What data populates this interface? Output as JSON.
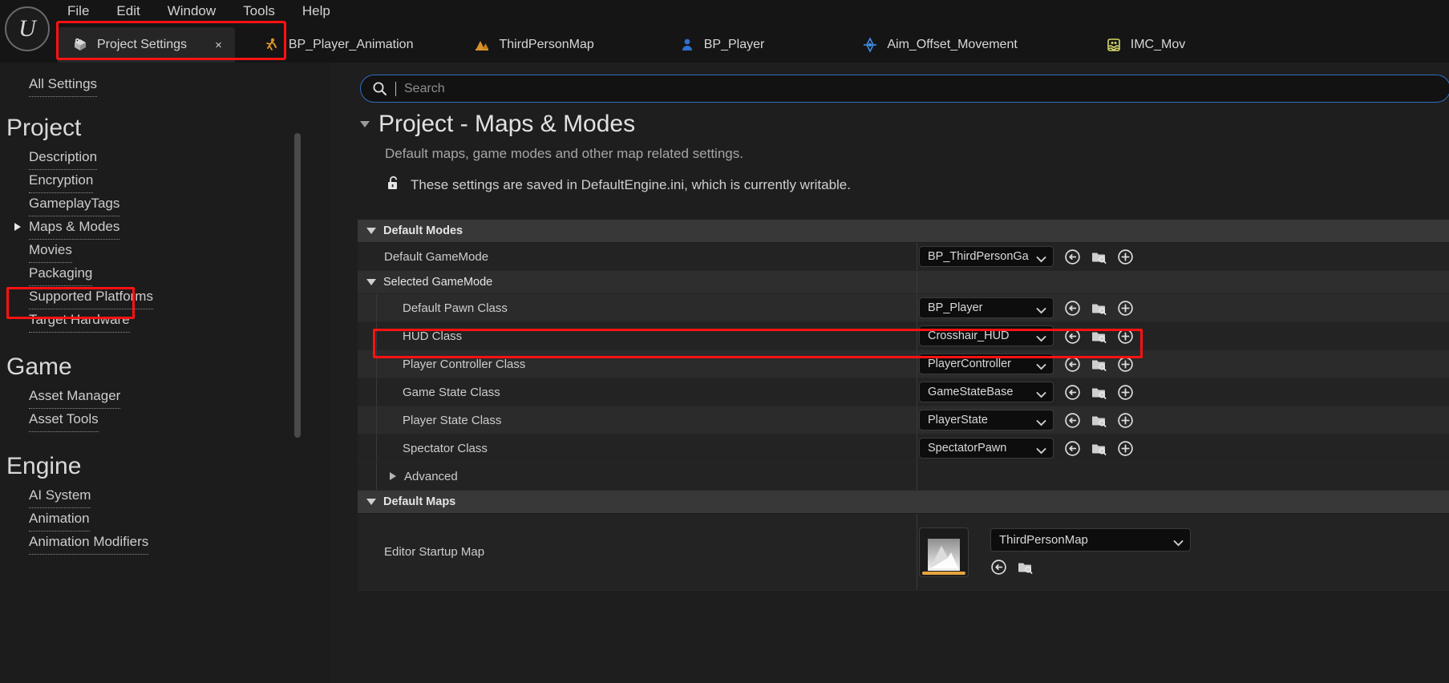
{
  "window": {
    "logo_glyph": "U"
  },
  "menubar": {
    "items": [
      {
        "label": "File"
      },
      {
        "label": "Edit"
      },
      {
        "label": "Window"
      },
      {
        "label": "Tools"
      },
      {
        "label": "Help"
      }
    ]
  },
  "tabs": [
    {
      "label": "Project Settings",
      "icon": "settings-box-icon",
      "active": true,
      "close": "×"
    },
    {
      "label": "BP_Player_Animation",
      "icon": "animation-blueprint-icon",
      "active": false
    },
    {
      "label": "ThirdPersonMap",
      "icon": "level-map-icon",
      "active": false
    },
    {
      "label": "BP_Player",
      "icon": "blueprint-actor-icon",
      "active": false
    },
    {
      "label": "Aim_Offset_Movement",
      "icon": "aim-offset-icon",
      "active": false
    },
    {
      "label": "IMC_Mov",
      "icon": "input-mapping-context-icon",
      "active": false
    }
  ],
  "sidebar": {
    "all_settings": "All Settings",
    "groups": [
      {
        "title": "Project",
        "items": [
          {
            "label": "Description",
            "selected": false
          },
          {
            "label": "Encryption",
            "selected": false
          },
          {
            "label": "GameplayTags",
            "selected": false
          },
          {
            "label": "Maps & Modes",
            "selected": true
          },
          {
            "label": "Movies",
            "selected": false
          },
          {
            "label": "Packaging",
            "selected": false
          },
          {
            "label": "Supported Platforms",
            "selected": false
          },
          {
            "label": "Target Hardware",
            "selected": false
          }
        ]
      },
      {
        "title": "Game",
        "items": [
          {
            "label": "Asset Manager",
            "selected": false
          },
          {
            "label": "Asset Tools",
            "selected": false
          }
        ]
      },
      {
        "title": "Engine",
        "items": [
          {
            "label": "AI System",
            "selected": false
          },
          {
            "label": "Animation",
            "selected": false
          },
          {
            "label": "Animation Modifiers",
            "selected": false
          }
        ]
      }
    ]
  },
  "search": {
    "placeholder": "Search",
    "value": ""
  },
  "page": {
    "title": "Project - Maps & Modes",
    "subtitle": "Default maps, game modes and other map related settings.",
    "note": "These settings are saved in DefaultEngine.ini, which is currently writable.",
    "note_icon": "unlock-icon"
  },
  "sections": {
    "default_modes": {
      "label": "Default Modes",
      "default_gamemode": {
        "label": "Default GameMode",
        "value": "BP_ThirdPersonGa"
      },
      "selected_gamemode": {
        "label": "Selected GameMode",
        "rows": [
          {
            "label": "Default Pawn Class",
            "value": "BP_Player",
            "highlighted": false
          },
          {
            "label": "HUD Class",
            "value": "Crosshair_HUD",
            "highlighted": true
          },
          {
            "label": "Player Controller Class",
            "value": "PlayerController",
            "highlighted": false
          },
          {
            "label": "Game State Class",
            "value": "GameStateBase",
            "highlighted": false
          },
          {
            "label": "Player State Class",
            "value": "PlayerState",
            "highlighted": false
          },
          {
            "label": "Spectator Class",
            "value": "SpectatorPawn",
            "highlighted": false
          }
        ],
        "advanced_label": "Advanced"
      }
    },
    "default_maps": {
      "label": "Default Maps",
      "editor_startup_map": {
        "label": "Editor Startup Map",
        "value": "ThirdPersonMap",
        "thumb_icon": "map-thumbnail-icon"
      }
    }
  },
  "row_icons": {
    "reset": "reset-to-default-icon",
    "browse": "browse-content-icon",
    "add": "add-new-icon"
  },
  "colors": {
    "highlight": "#ff1212",
    "accent": "#e8a33d",
    "search_border": "#2f6fbf"
  }
}
